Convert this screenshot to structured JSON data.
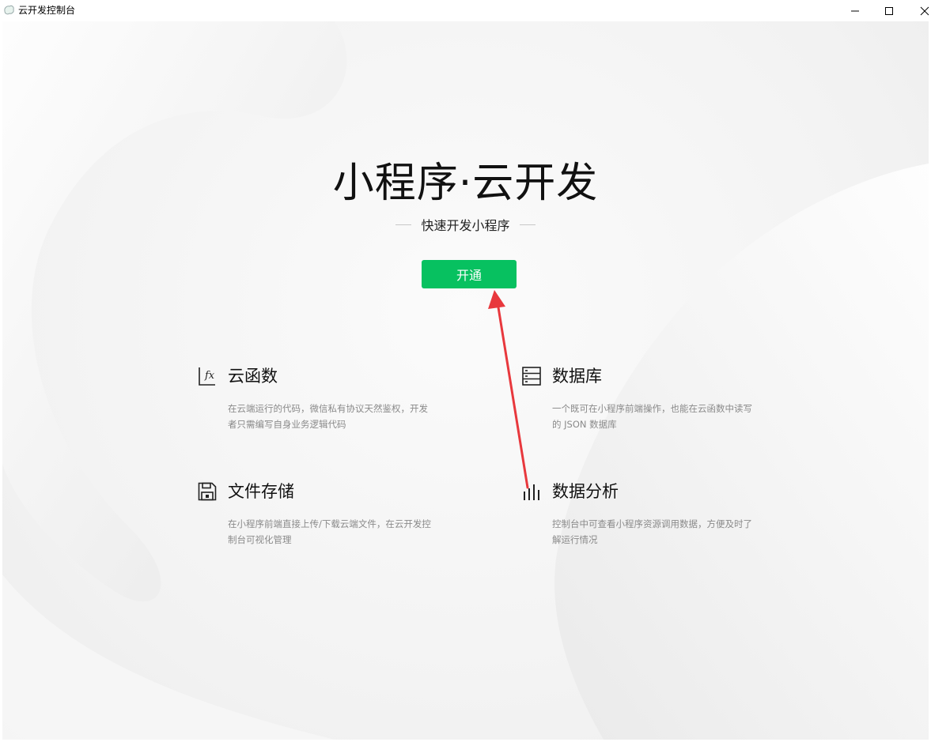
{
  "window": {
    "title": "云开发控制台"
  },
  "hero": {
    "title": "小程序·云开发",
    "subtitle": "快速开发小程序",
    "open_button": "开通"
  },
  "features": [
    {
      "icon": "function-icon",
      "title": "云函数",
      "description": "在云端运行的代码，微信私有协议天然鉴权，开发者只需编写自身业务逻辑代码"
    },
    {
      "icon": "database-icon",
      "title": "数据库",
      "description": "一个既可在小程序前端操作，也能在云函数中读写的 JSON 数据库"
    },
    {
      "icon": "floppy-disk-icon",
      "title": "文件存储",
      "description": "在小程序前端直接上传/下载云端文件，在云开发控制台可视化管理"
    },
    {
      "icon": "bar-chart-icon",
      "title": "数据分析",
      "description": "控制台中可查看小程序资源调用数据，方便及时了解运行情况"
    }
  ],
  "colors": {
    "accent": "#07c160",
    "annotation_arrow": "#e8383d"
  }
}
